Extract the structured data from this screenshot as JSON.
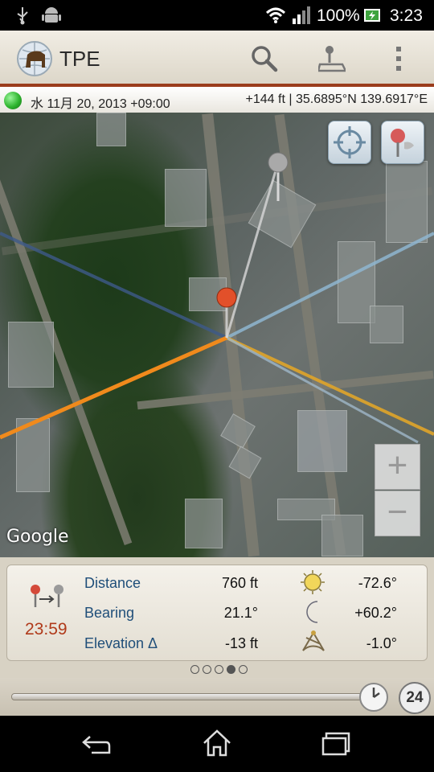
{
  "status_bar": {
    "battery_percent": "100%",
    "time": "3:23",
    "icons": [
      "usb-icon",
      "android-icon",
      "wifi-icon",
      "signal-icon",
      "battery-charging-icon"
    ]
  },
  "action_bar": {
    "title": "TPE",
    "icons": [
      "app-logo-icon",
      "search-icon",
      "location-map-icon",
      "overflow-menu-icon"
    ]
  },
  "info_strip": {
    "date": "水 11月 20, 2013 +09:00",
    "location": "+144 ft | 35.6895°N 139.6917°E",
    "status_color": "#2fb52f"
  },
  "map": {
    "watermark": "Google",
    "buttons": [
      "locate-icon",
      "pin-select-icon"
    ],
    "zoom_in": "+",
    "zoom_out": "−",
    "line_colors": {
      "sun": "#f08a1c",
      "moon": "#8fb6d0",
      "twilight": "#e0a52a",
      "geodesic": "#3e5a8a",
      "bearing": "#d8d8d8"
    }
  },
  "panel": {
    "time": "23:59",
    "rows": [
      {
        "label": "Distance",
        "value": "760 ft",
        "icon": "sun-icon",
        "angle": "-72.6°"
      },
      {
        "label": "Bearing",
        "value": "21.1°",
        "icon": "moon-icon",
        "angle": "+60.2°"
      },
      {
        "label": "Elevation Δ",
        "value": "-13 ft",
        "icon": "sextant-icon",
        "angle": "-1.0°"
      }
    ],
    "pages": 5,
    "active_page": 4,
    "day_button": "24"
  },
  "nav_bar": {
    "icons": [
      "back-icon",
      "home-icon",
      "recents-icon"
    ]
  }
}
